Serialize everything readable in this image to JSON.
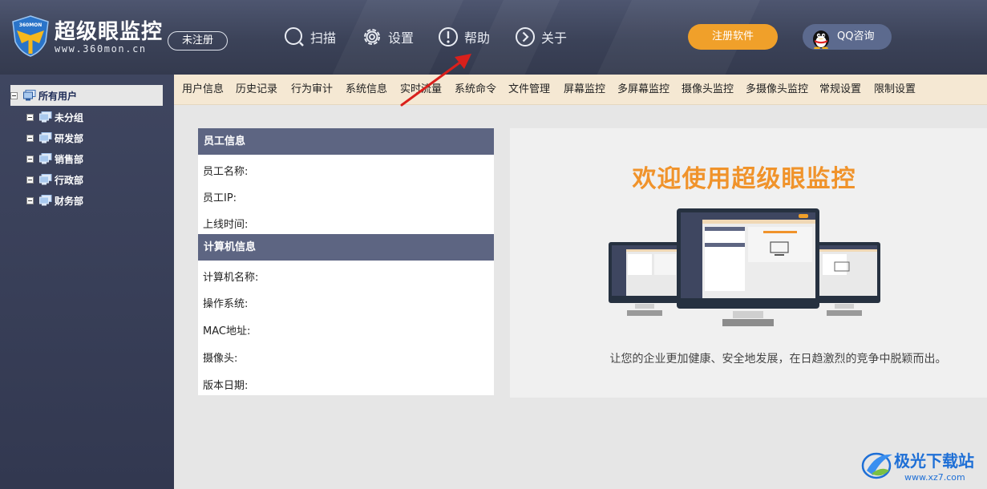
{
  "brand": {
    "title": "超级眼监控",
    "subtitle": "www.360mon.cn",
    "badge": "360MON",
    "unregistered_label": "未注册"
  },
  "topnav": {
    "scan": "扫描",
    "settings": "设置",
    "help": "帮助",
    "about": "关于",
    "register_button": "注册软件",
    "qq_button": "QQ咨询"
  },
  "sidebar": {
    "root": "所有用户",
    "groups": [
      "未分组",
      "研发部",
      "销售部",
      "行政部",
      "财务部"
    ]
  },
  "tabs": [
    "用户信息",
    "历史记录",
    "行为审计",
    "系统信息",
    "实时流量",
    "系统命令",
    "文件管理",
    "屏幕监控",
    "多屏幕监控",
    "摄像头监控",
    "多摄像头监控",
    "常规设置",
    "限制设置"
  ],
  "employee_info": {
    "header": "员工信息",
    "name_label": "员工名称:",
    "ip_label": "员工IP:",
    "online_time_label": "上线时间:"
  },
  "computer_info": {
    "header": "计算机信息",
    "computer_name_label": "计算机名称:",
    "os_label": "操作系统:",
    "mac_label": "MAC地址:",
    "camera_label": "摄像头:",
    "version_date_label": "版本日期:"
  },
  "welcome": {
    "title": "欢迎使用超级眼监控",
    "subtitle": "让您的企业更加健康、安全地发展，在日趋激烈的竞争中脱颖而出。"
  },
  "watermark": {
    "title": "极光下载站",
    "url": "www.xz7.com"
  },
  "colors": {
    "header_bg": "#3b4258",
    "accent_orange": "#f0a02a",
    "panel_header": "#5d6582",
    "tabbar_bg": "#f5e8d3",
    "welcome_title": "#f0932b",
    "arrow_red": "#d9201c"
  }
}
